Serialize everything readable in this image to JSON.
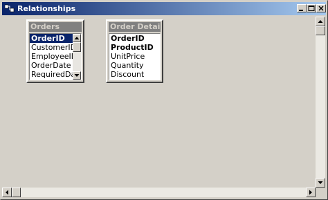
{
  "window": {
    "title": "Relationships"
  },
  "tables": [
    {
      "name": "Orders",
      "fields": [
        "OrderID",
        "CustomerID",
        "EmployeeID",
        "OrderDate",
        "RequiredDate"
      ],
      "selected_index": 0,
      "primary_keys": []
    },
    {
      "name": "Order Details",
      "fields": [
        "OrderID",
        "ProductID",
        "UnitPrice",
        "Quantity",
        "Discount"
      ],
      "selected_index": -1,
      "primary_keys": [
        "OrderID",
        "ProductID"
      ]
    }
  ],
  "icons": {
    "app": "relationships-icon",
    "minimize": "minimize-icon",
    "maximize": "maximize-icon",
    "close": "close-icon",
    "up": "arrow-up-icon",
    "down": "arrow-down-icon",
    "left": "arrow-left-icon",
    "right": "arrow-right-icon"
  },
  "colors": {
    "title_active": "#0a246a",
    "title_fade": "#a6caf0",
    "selection": "#0a246a",
    "face": "#d4d0c8"
  }
}
